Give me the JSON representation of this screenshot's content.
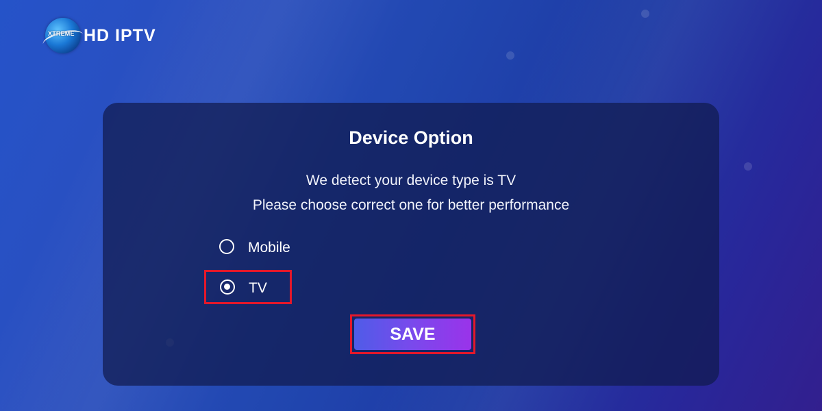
{
  "brand": {
    "badge_text": "XTREME",
    "name": "HD IPTV",
    "logo_icon": "globe-logo-icon"
  },
  "dialog": {
    "title": "Device Option",
    "message_line1": "We detect your device type is TV",
    "message_line2": "Please choose correct one for better performance",
    "options": [
      {
        "label": "Mobile",
        "selected": false,
        "icon": "radio-unchecked-icon"
      },
      {
        "label": "TV",
        "selected": true,
        "icon": "radio-checked-icon"
      }
    ],
    "save_label": "SAVE"
  },
  "colors": {
    "background": "#2147b0",
    "panel": "#101a4e",
    "highlight_border": "#e5182a",
    "save_button_start": "#4f5ce8",
    "save_button_end": "#9a33ea",
    "text": "#ffffff"
  }
}
